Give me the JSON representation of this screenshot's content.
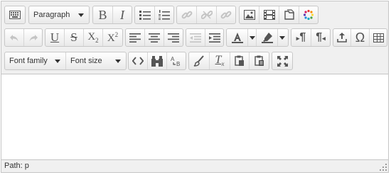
{
  "toolbar": {
    "block_format": {
      "value": "Paragraph"
    },
    "font_family": {
      "value": "Font family"
    },
    "font_size": {
      "value": "Font size"
    },
    "bold_label": "B",
    "italic_label": "I",
    "underline_label": "U",
    "strike_label": "S",
    "subscript_label": "X",
    "subscript_mark": "2",
    "superscript_label": "X",
    "superscript_mark": "2",
    "ltr_label": "¶",
    "rtl_label": "¶",
    "charmap_label": "Ω",
    "clear_format_label": "T",
    "clear_format_mark": "x"
  },
  "statusbar": {
    "path_label": "Path: p"
  }
}
